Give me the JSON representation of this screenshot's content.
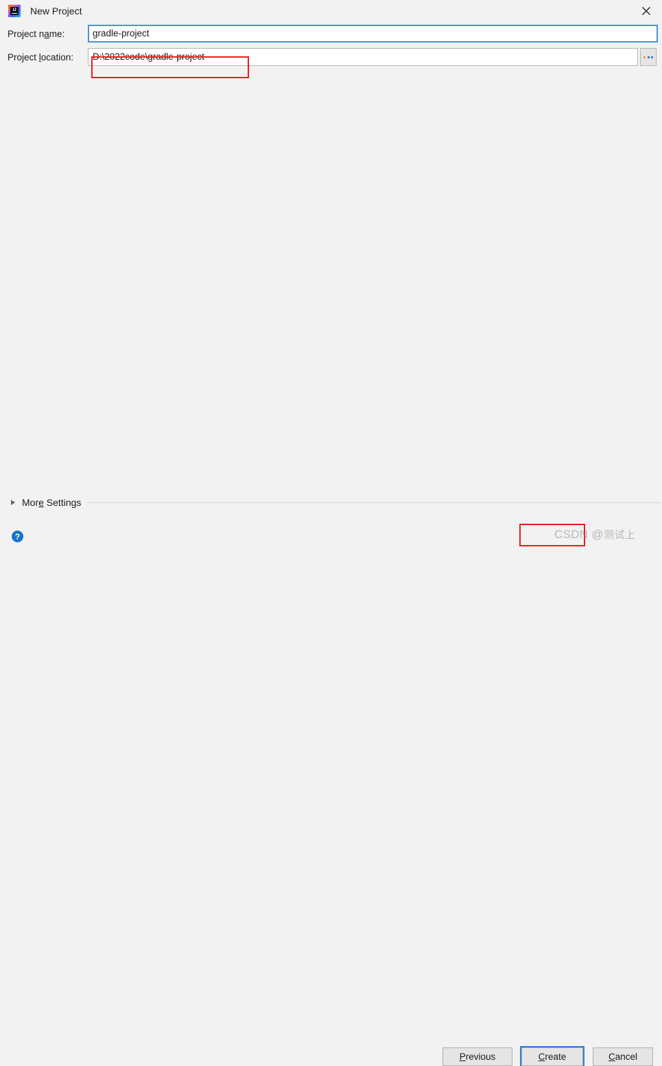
{
  "window": {
    "title": "New Project",
    "app_icon": "intellij-idea-icon",
    "icon_text": "IJ",
    "close_icon": "close-icon"
  },
  "form": {
    "fields": [
      {
        "label_pre": "Project n",
        "label_mnemonic": "a",
        "label_post": "me:",
        "value": "gradle-project",
        "focused": true
      },
      {
        "label_pre": "Project ",
        "label_mnemonic": "l",
        "label_post": "ocation:",
        "value": "D:\\2022code\\gradle-project",
        "focused": false
      }
    ],
    "browse_button_label": "...",
    "browse_icon": "ellipsis-icon"
  },
  "more_settings": {
    "label_pre": "Mor",
    "label_mnemonic": "e",
    "label_post": " Settings",
    "expanded": false,
    "disclosure_icon": "triangle-right-icon"
  },
  "footer": {
    "help_icon": "help-question-icon",
    "help_label": "?",
    "buttons": [
      {
        "pre": "",
        "mnemonic": "P",
        "post": "revious",
        "default": false
      },
      {
        "pre": "",
        "mnemonic": "C",
        "post": "reate",
        "default": true
      },
      {
        "pre": "",
        "mnemonic": "C",
        "post": "ancel",
        "default": false
      }
    ]
  },
  "annotations": {
    "color": "#f01b1b",
    "boxes": [
      "project-location-field",
      "create-button"
    ]
  },
  "watermark": {
    "text_latin": "CSDN @",
    "text_cjk": "测试上"
  }
}
